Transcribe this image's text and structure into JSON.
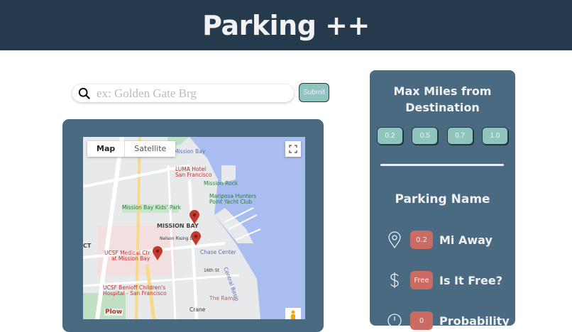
{
  "header": {
    "title": "Parking ++"
  },
  "search": {
    "placeholder": "ex: Golden Gate Brg",
    "value": "",
    "submit_label": "Submit"
  },
  "map": {
    "map_type": {
      "map": "Map",
      "satellite": "Satellite"
    },
    "labels": {
      "mission_bay_water": "Mission Bay",
      "luma1": "LUMA Hotel",
      "luma2": "San Francisco",
      "mission_rock": "Mission Rock",
      "mariposa1": "Mariposa Hunters",
      "mariposa2": "Point Yacht Club",
      "kids_park": "Mission Bay Kids' Park",
      "mission_bay": "MISSION BAY",
      "nelson": "Nelson Rising Ln",
      "ucsf1": "UCSF Medical Ctr",
      "ucsf2": "at Mission Bay",
      "chase": "Chase Center",
      "benioff1": "UCSF Benioff Children's",
      "benioff2": "Hospital - San Francisco",
      "central_basin": "Central Basin",
      "the_ramp": "The Ramp",
      "crane": "Crane",
      "plow": "Plow",
      "street_16th": "16th St",
      "ct": "CT"
    }
  },
  "panel": {
    "max_miles_title": "Max Miles from Destination",
    "miles_options": [
      "0.2",
      "0.5",
      "0.7",
      "1.0"
    ],
    "parking_name": "Parking Name",
    "rows": [
      {
        "icon": "location-pin-icon",
        "badge": "0.2",
        "label": "Mi Away"
      },
      {
        "icon": "dollar-icon",
        "badge": "Free",
        "label": "Is It Free?"
      },
      {
        "icon": "clock-icon",
        "badge": "0",
        "label": "Probability"
      }
    ]
  },
  "colors": {
    "header": "#263a4e",
    "panel": "#4a6a82",
    "accent": "#8fc5bd",
    "badge": "#cc6b61"
  }
}
